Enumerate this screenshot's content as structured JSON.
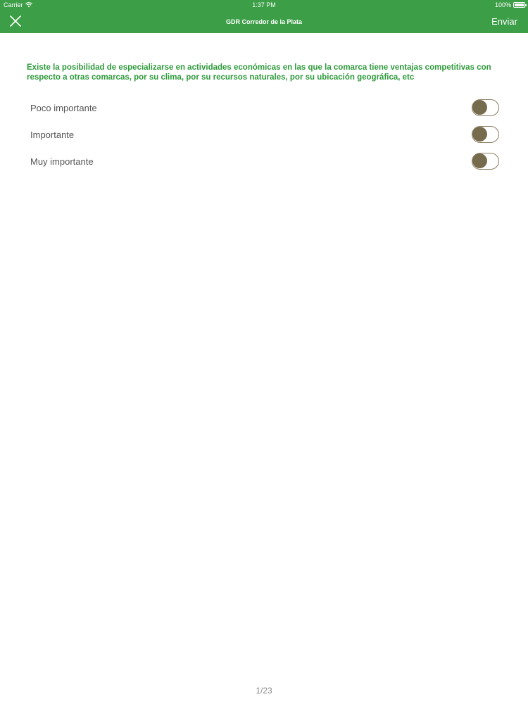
{
  "status_bar": {
    "carrier": "Carrier",
    "time": "1:37 PM",
    "battery": "100%"
  },
  "nav": {
    "title": "GDR Corredor de la Plata",
    "send_label": "Enviar",
    "close_icon": "close-icon"
  },
  "question": "Existe la posibilidad de especializarse en actividades económicas en las que la comarca tiene ventajas competitivas con respecto a otras comarcas, por su clima, por su recursos naturales, por su ubicación geográfica, etc",
  "options": [
    {
      "label": "Poco importante",
      "selected": false
    },
    {
      "label": "Importante",
      "selected": false
    },
    {
      "label": "Muy importante",
      "selected": false
    }
  ],
  "pager": "1/23",
  "colors": {
    "header": "#3d9e48",
    "question": "#2e9a3b",
    "toggle": "#776b4e"
  }
}
